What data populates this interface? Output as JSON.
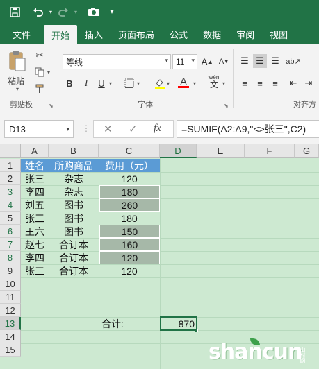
{
  "quick_access": {
    "save_icon": "save-icon",
    "undo_icon": "undo-icon",
    "redo_icon": "redo-icon",
    "camera_icon": "camera-icon",
    "customize_icon": "chevron-down-icon"
  },
  "tabs": [
    "文件",
    "开始",
    "插入",
    "页面布局",
    "公式",
    "数据",
    "审阅",
    "视图"
  ],
  "active_tab": "开始",
  "ribbon": {
    "clipboard": {
      "paste_label": "粘贴",
      "group_label": "剪贴板"
    },
    "font": {
      "font_name": "等线",
      "font_size": "11",
      "bold": "B",
      "italic": "I",
      "underline": "U",
      "font_color_label": "A",
      "phonetic_label": "wén",
      "group_label": "字体"
    },
    "alignment": {
      "group_label": "对齐方"
    }
  },
  "formula_bar": {
    "name_box": "D13",
    "cancel_symbol": "✕",
    "enter_symbol": "✓",
    "fx_label": "fx",
    "formula": "=SUMIF(A2:A9,\"<>张三\",C2)"
  },
  "columns": [
    "A",
    "B",
    "C",
    "D",
    "E",
    "F",
    "G"
  ],
  "rows": [
    "1",
    "2",
    "3",
    "4",
    "5",
    "6",
    "7",
    "8",
    "9",
    "10",
    "11",
    "12",
    "13",
    "14",
    "15"
  ],
  "table": {
    "headers": [
      "姓名",
      "所购商品",
      "费用（元）"
    ],
    "rows": [
      [
        "张三",
        "杂志",
        "120"
      ],
      [
        "李四",
        "杂志",
        "180"
      ],
      [
        "刘五",
        "图书",
        "260"
      ],
      [
        "张三",
        "图书",
        "180"
      ],
      [
        "王六",
        "图书",
        "150"
      ],
      [
        "赵七",
        "合订本",
        "160"
      ],
      [
        "李四",
        "合订本",
        "120"
      ],
      [
        "张三",
        "合订本",
        "120"
      ]
    ]
  },
  "total": {
    "label": "合计:",
    "value": "870"
  },
  "watermark": {
    "text": "shancun",
    "small": "山村网"
  },
  "colors": {
    "title_green": "#217346",
    "sheet_bg": "#cde9d1",
    "header_fill": "#5b9bd5",
    "highlight_fill": "#a6b8a8"
  }
}
